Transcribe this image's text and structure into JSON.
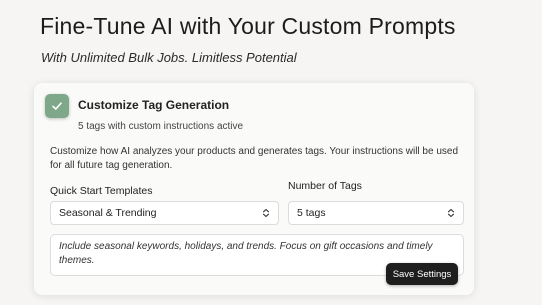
{
  "hero": {
    "title": "Fine-Tune AI with Your Custom Prompts",
    "subtitle": "With Unlimited Bulk Jobs. Limitless Potential"
  },
  "card": {
    "title": "Customize Tag Generation",
    "status": "5 tags with custom instructions active",
    "description": "Customize how AI analyzes your products and generates tags. Your instructions will be used for all future tag generation.",
    "checked": true,
    "check_color": "#7fa88a"
  },
  "templates": {
    "label": "Quick Start Templates",
    "selected": "Seasonal & Trending"
  },
  "tag_count": {
    "label": "Number of Tags",
    "selected": "5 tags"
  },
  "instructions": {
    "value": "Include seasonal keywords, holidays, and trends. Focus on gift occasions and timely themes."
  },
  "save_button": {
    "label": "Save Settings"
  },
  "icons": {
    "check": "check-icon",
    "select_chevron": "chevron-up-down-icon"
  }
}
